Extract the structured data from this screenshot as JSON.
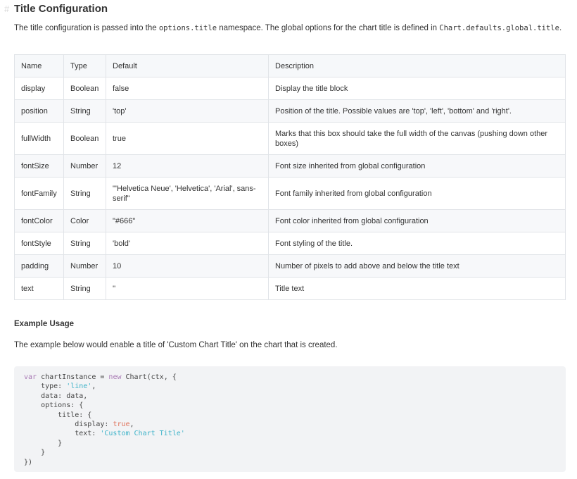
{
  "heading": {
    "anchor": "#",
    "title": "Title Configuration"
  },
  "intro": {
    "before": "The title configuration is passed into the ",
    "code1": "options.title",
    "middle": " namespace. The global options for the chart title is defined in ",
    "code2": "Chart.defaults.global.title",
    "after": "."
  },
  "table": {
    "headers": [
      "Name",
      "Type",
      "Default",
      "Description"
    ],
    "rows": [
      [
        "display",
        "Boolean",
        "false",
        "Display the title block"
      ],
      [
        "position",
        "String",
        "'top'",
        "Position of the title. Possible values are 'top', 'left', 'bottom' and 'right'."
      ],
      [
        "fullWidth",
        "Boolean",
        "true",
        "Marks that this box should take the full width of the canvas (pushing down other boxes)"
      ],
      [
        "fontSize",
        "Number",
        "12",
        "Font size inherited from global configuration"
      ],
      [
        "fontFamily",
        "String",
        "\"'Helvetica Neue', 'Helvetica', 'Arial', sans-serif\"",
        "Font family inherited from global configuration"
      ],
      [
        "fontColor",
        "Color",
        "\"#666\"",
        "Font color inherited from global configuration"
      ],
      [
        "fontStyle",
        "String",
        "'bold'",
        "Font styling of the title."
      ],
      [
        "padding",
        "Number",
        "10",
        "Number of pixels to add above and below the title text"
      ],
      [
        "text",
        "String",
        "''",
        "Title text"
      ]
    ]
  },
  "example": {
    "heading": "Example Usage",
    "description": "The example below would enable a title of 'Custom Chart Title' on the chart that is created.",
    "code": {
      "l1_kw": "var",
      "l1_a": " chartInstance = ",
      "l1_new": "new",
      "l1_b": " Chart(ctx, {",
      "l2_a": "    type: ",
      "l2_str": "'line'",
      "l2_b": ",",
      "l3": "    data: data,",
      "l4": "    options: {",
      "l5": "        title: {",
      "l6_a": "            display: ",
      "l6_bool": "true",
      "l6_b": ",",
      "l7_a": "            text: ",
      "l7_str": "'Custom Chart Title'",
      "l8": "        }",
      "l9": "    }",
      "l10": "})"
    }
  }
}
